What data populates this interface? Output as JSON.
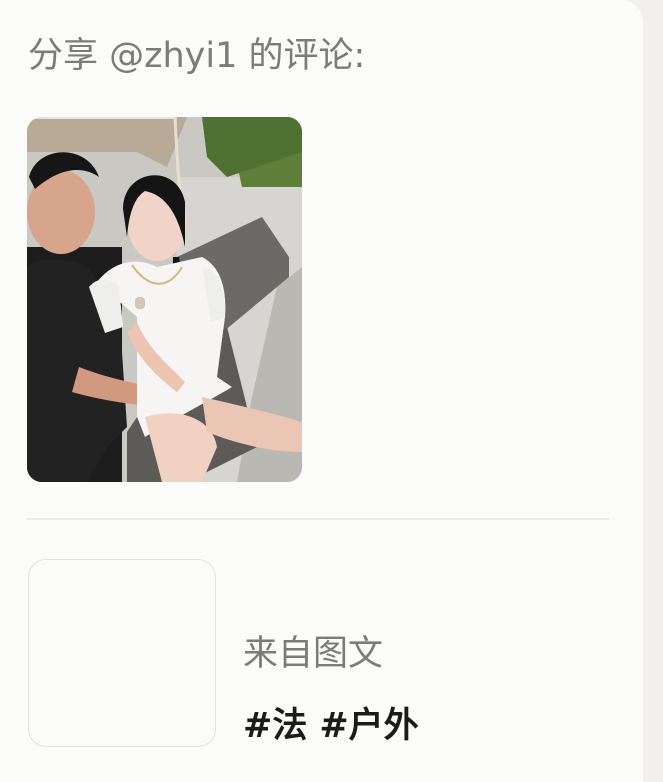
{
  "share": {
    "title": "分享 @zhyi1 的评论:"
  },
  "post": {
    "photo_icon": "photo-image"
  },
  "source_card": {
    "thumbnail_icon": "blank-thumbnail",
    "label": "来自图文",
    "tags": [
      "#法",
      "#户外"
    ]
  }
}
